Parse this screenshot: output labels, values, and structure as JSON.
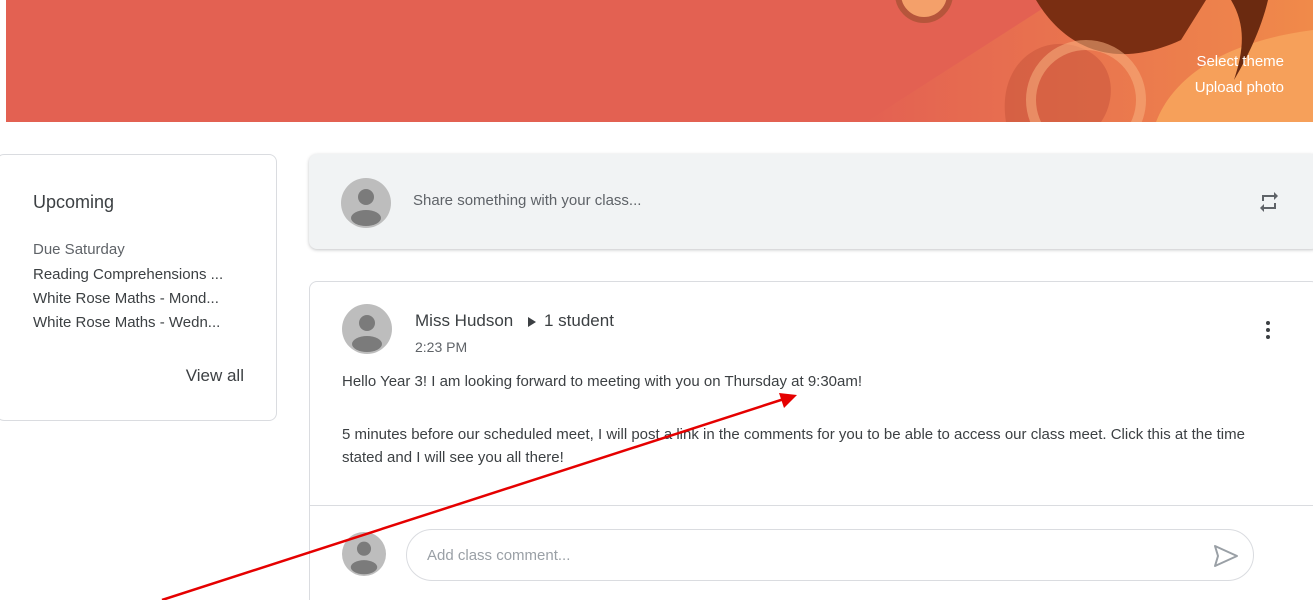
{
  "banner": {
    "select_theme": "Select theme",
    "upload_photo": "Upload photo",
    "color": "#e36152"
  },
  "upcoming": {
    "title": "Upcoming",
    "due_label": "Due Saturday",
    "items": [
      {
        "label": "Reading Comprehensions ..."
      },
      {
        "label": "White Rose Maths - Mond..."
      },
      {
        "label": "White Rose Maths - Wedn..."
      }
    ],
    "view_all": "View all"
  },
  "share": {
    "prompt": "Share something with your class...",
    "icon": "repost-icon"
  },
  "post": {
    "author": "Miss Hudson",
    "audience": "1 student",
    "time": "2:23 PM",
    "paragraphs": [
      "Hello Year 3! I am looking forward to meeting with you on Thursday at 9:30am!",
      "5 minutes before our scheduled meet, I will post a link in the comments for you to be able to access our class meet. Click this at the time stated and I will see you all there!"
    ],
    "comment_placeholder": "Add class comment...",
    "more_icon": "more-vert-icon",
    "send_icon": "send-icon"
  },
  "annotation": {
    "arrow_color": "#e50000"
  }
}
